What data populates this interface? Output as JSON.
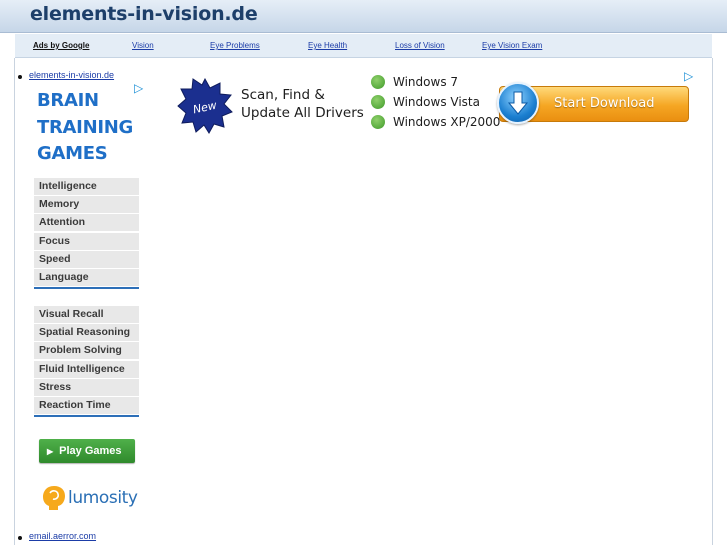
{
  "site": {
    "title": "elements-in-vision.de"
  },
  "adbar": {
    "ads_by": "Ads by Google",
    "links": [
      "Vision",
      "Eye Problems",
      "Eye Health",
      "Loss of Vision",
      "Eye Vision Exam"
    ]
  },
  "sidebar": {
    "top_link": "elements-in-vision.de",
    "bottom_link": "email.aerror.com"
  },
  "brain_ad": {
    "title_lines": [
      "BRAIN",
      "TRAINING",
      "GAMES"
    ],
    "group1": [
      "Intelligence",
      "Memory",
      "Attention",
      "Focus",
      "Speed",
      "Language"
    ],
    "group2": [
      "Visual Recall",
      "Spatial Reasoning",
      "Problem Solving",
      "Fluid Intelligence",
      "Stress",
      "Reaction Time"
    ],
    "play_label": "Play Games",
    "logo_text": "lumosity",
    "adchoice_icon": "adchoices-triangle-icon"
  },
  "driver_ad": {
    "badge": "New",
    "headline_lines": [
      "Scan, Find &",
      "Update All Drivers"
    ],
    "os_list": [
      "Windows 7",
      "Windows Vista",
      "Windows XP/2000"
    ],
    "download_label": "Start Download",
    "accent": "#f5a623",
    "check_color": "#3f9a2a"
  }
}
